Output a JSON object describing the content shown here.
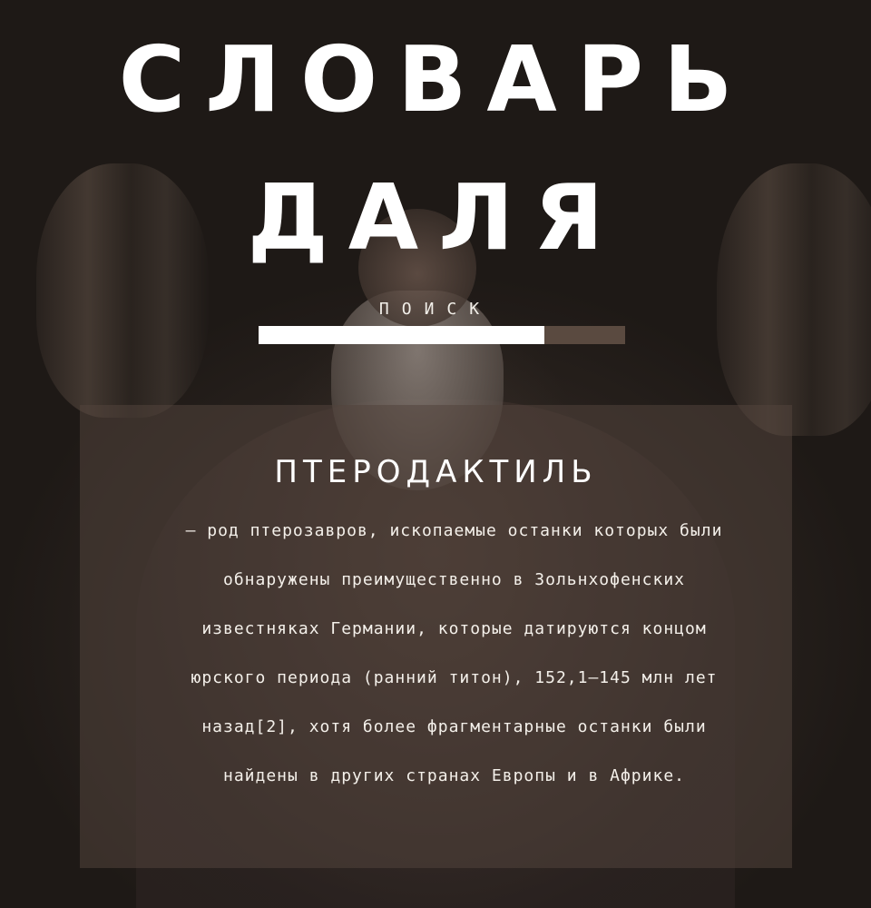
{
  "header": {
    "title_line1": "СЛОВАРЬ",
    "title_line2": "ДАЛЯ"
  },
  "search": {
    "label": "ПОИСК",
    "progress_fraction": 0.78
  },
  "entry": {
    "word": "ПТЕРОДАКТИЛЬ",
    "definition": "– род птерозавров, ископаемые останки которых были обнаружены преимущественно в Зольнхофенских известняках Германии, которые датируются концом юрского периода (ранний титон), 152,1–145 млн лет назад[2], хотя более фрагментарные останки были найдены в других странах Европы и в Африке."
  },
  "colors": {
    "background": "#221d1a",
    "card": "#52443c",
    "bar_track": "#5a4a40",
    "bar_fill": "#ffffff",
    "text": "#ffffff"
  },
  "icons": {
    "background_image": "portrait-painting"
  }
}
